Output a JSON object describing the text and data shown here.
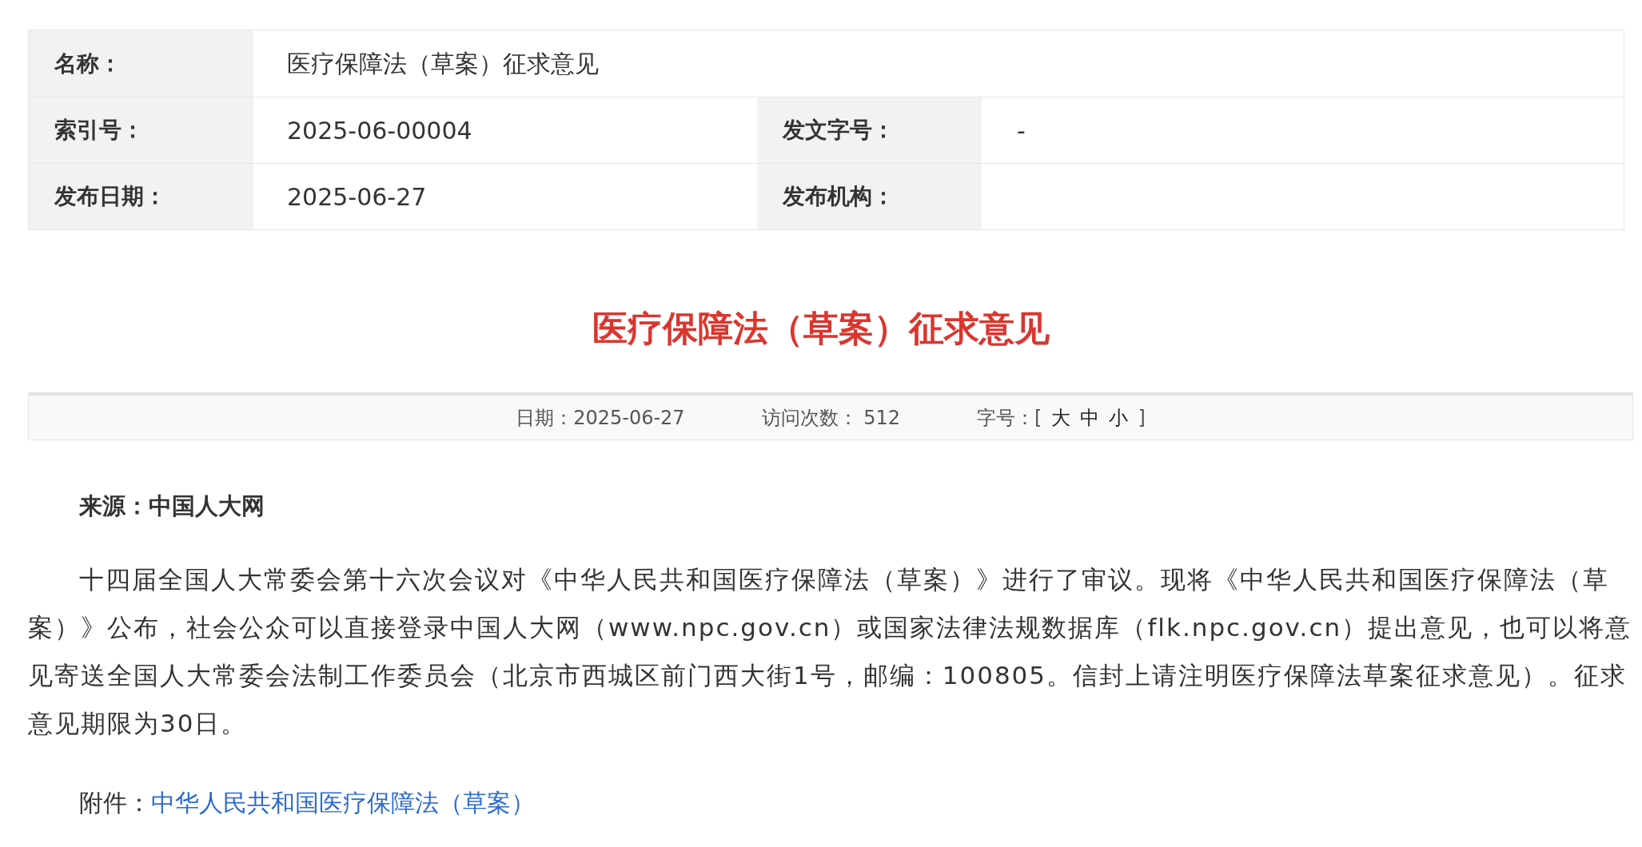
{
  "info_table": {
    "rows": [
      {
        "cells": [
          {
            "label": "名称：",
            "value": "医疗保障法（草案）征求意见"
          }
        ]
      },
      {
        "cells": [
          {
            "label": "索引号：",
            "value": "2025-06-00004"
          },
          {
            "label": "发文字号：",
            "value": "-"
          }
        ]
      },
      {
        "cells": [
          {
            "label": "发布日期：",
            "value": "2025-06-27"
          },
          {
            "label": "发布机构："
          }
        ]
      }
    ]
  },
  "article": {
    "title": "医疗保障法（草案）征求意见",
    "meta": {
      "date": "日期：2025-06-27",
      "visits": "访问次数： 512",
      "font_size_label": "字号：",
      "bracket_open": "[",
      "sizes": [
        "大",
        "中",
        "小"
      ],
      "bracket_close": "]"
    },
    "source": "来源：中国人大网",
    "body": "十四届全国人大常委会第十六次会议对《中华人民共和国医疗保障法（草案）》进行了审议。现将《中华人民共和国医疗保障法（草案）》公布，社会公众可以直接登录中国人大网（www.npc.gov.cn）或国家法律法规数据库（flk.npc.gov.cn）提出意见，也可以将意见寄送全国人大常委会法制工作委员会（北京市西城区前门西大街1号，邮编：100805。信封上请注明医疗保障法草案征求意见）。征求意见期限为30日。",
    "attachment_label": "附件：",
    "attachment_link": "中华人民共和国医疗保障法（草案）"
  }
}
